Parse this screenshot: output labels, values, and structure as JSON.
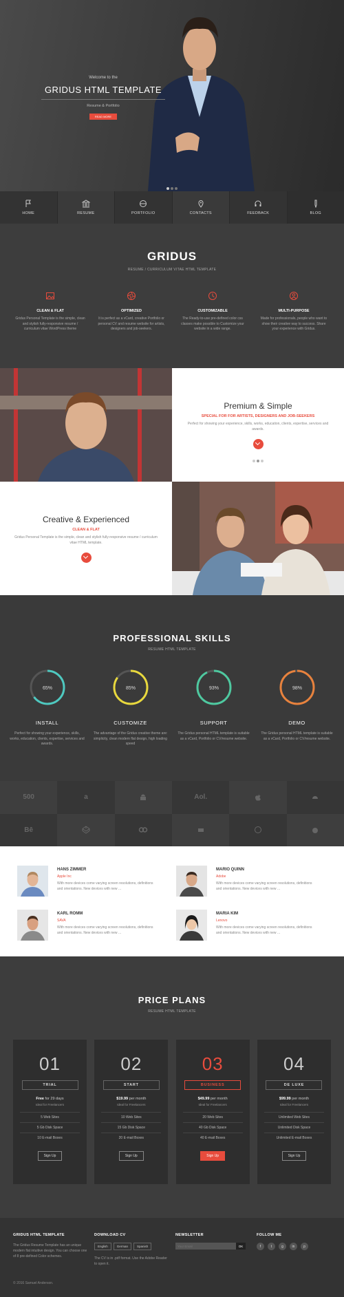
{
  "hero": {
    "welcome": "Welcome to the",
    "title": "GRIDUS HTML TEMPLATE",
    "subtitle": "Resume & Portfolio",
    "button": "READ MORE"
  },
  "nav": [
    {
      "label": "HOME",
      "icon": "flag-icon"
    },
    {
      "label": "RESUME",
      "icon": "bank-icon"
    },
    {
      "label": "PORTFOLIO",
      "icon": "globe-icon"
    },
    {
      "label": "CONTACTS",
      "icon": "pin-icon"
    },
    {
      "label": "FEEDBACK",
      "icon": "headset-icon"
    },
    {
      "label": "BLOG",
      "icon": "pen-icon"
    }
  ],
  "intro": {
    "title": "GRIDUS",
    "subtitle": "RESUME / CURRICULUM VITAE HTML TEMPLATE",
    "features": [
      {
        "title": "CLEAN & FLAT",
        "desc": "Gridus Personal Template is the simple, clean and stylish fully-responsive resume / curriculum vitae WordPress theme",
        "icon": "image-icon"
      },
      {
        "title": "OPTIMIZED",
        "desc": "It is perfect as a vCard, creative Portfolio or personal CV and resume website for artists, designers and job-seekers.",
        "icon": "aperture-icon"
      },
      {
        "title": "CUSTOMIZABLE",
        "desc": "The Ready-to-use pre-defined color css classes make possible to Customize your website in a wide range.",
        "icon": "clock-icon"
      },
      {
        "title": "MULTI-PURPOSE",
        "desc": "Made for professionals, people who want to show their creative way to success. Share your experience with Gridus.",
        "icon": "user-icon"
      }
    ]
  },
  "block1": {
    "title": "Premium & Simple",
    "sub": "SPECIAL FOR FOR ARTISTS, DESIGNERS AND JOB-SEEKERS",
    "desc": "Perfect for showing your experience, skills, works, education, clients, expertise, services and awards."
  },
  "block2": {
    "title": "Creative & Experienced",
    "sub": "CLEAN & FLAT",
    "desc": "Gridus Personal Template is the simple, clean and stylish fully-responsive resume / curriculum vitae HTML template."
  },
  "skills": {
    "title": "PROFESSIONAL SKILLS",
    "subtitle": "RESUME HTML TEMPLATE",
    "items": [
      {
        "pct": "65%",
        "value": 0.65,
        "color": "#4ec9c0",
        "title": "INSTALL",
        "desc": "Perfect for showing your experience, skills, works, education, clients, expertise, services and awards."
      },
      {
        "pct": "85%",
        "value": 0.85,
        "color": "#e8d83d",
        "title": "CUSTOMIZE",
        "desc": "The advantage of the Gridus creative theme are: simplicity, clean modern flat design, high loading speed"
      },
      {
        "pct": "93%",
        "value": 0.93,
        "color": "#4ec9a0",
        "title": "SUPPORT",
        "desc": "The Gridus personal HTML template is suitable as a vCard, Portfolio or CV/resume website."
      },
      {
        "pct": "98%",
        "value": 0.98,
        "color": "#e8823d",
        "title": "DEMO",
        "desc": "The Gridus personal HTML template is suitable as a vCard, Portfolio or CV/resume website."
      }
    ]
  },
  "brands": [
    {
      "label": "500",
      "icon": "500px-icon"
    },
    {
      "label": "a",
      "icon": "amazon-icon"
    },
    {
      "label": "",
      "icon": "android-icon"
    },
    {
      "label": "Aol.",
      "icon": "aol-icon"
    },
    {
      "label": "",
      "icon": "apple-icon"
    },
    {
      "label": "",
      "icon": "cloud-icon"
    },
    {
      "label": "Bē",
      "icon": "behance-icon"
    },
    {
      "label": "",
      "icon": "codepen-icon"
    },
    {
      "label": "",
      "icon": "creative-commons-icon"
    },
    {
      "label": "",
      "icon": "delicious-icon"
    },
    {
      "label": "",
      "icon": "dribbble-icon"
    },
    {
      "label": "",
      "icon": "drupal-icon"
    }
  ],
  "team": [
    {
      "name": "HANS ZIMMER",
      "role": "Apple Inc",
      "desc": "With more devices come varying screen resolutions, definitions and orientations. New devices with new ..."
    },
    {
      "name": "MARIO QUINN",
      "role": "Adobe",
      "desc": "With more devices come varying screen resolutions, definitions and orientations. New devices with new ..."
    },
    {
      "name": "KARL ROMM",
      "role": "SAVA",
      "desc": "With more devices come varying screen resolutions, definitions and orientations. New devices with new ..."
    },
    {
      "name": "MARIA KIM",
      "role": "Lenovo",
      "desc": "With more devices come varying screen resolutions, definitions and orientations. New devices with new ..."
    }
  ],
  "pricing": {
    "title": "PRICE PLANS",
    "subtitle": "RESUME HTML TEMPLATE",
    "plans": [
      {
        "num": "01",
        "name": "TRIAL",
        "price_bold": "Free",
        "price_rest": " for 29 days",
        "note": "Ideal for Freelancers",
        "features": [
          "5 Web Sites",
          "5 Gb Disk Space",
          "10 E-mail Boxes"
        ],
        "button": "Sign Up"
      },
      {
        "num": "02",
        "name": "START",
        "price_bold": "$19.99",
        "price_rest": " per month",
        "note": "Ideal for Freelancers",
        "features": [
          "10 Web Sites",
          "15 Gb Disk Space",
          "20 E-mail Boxes"
        ],
        "button": "Sign Up"
      },
      {
        "num": "03",
        "name": "BUSINESS",
        "price_bold": "$49.99",
        "price_rest": " per month",
        "note": "Ideal for Freelancers",
        "features": [
          "20 Web Sites",
          "40 Gb Disk Space",
          "40 E-mail Boxes"
        ],
        "button": "Sign Up"
      },
      {
        "num": "04",
        "name": "DE LUXE",
        "price_bold": "$99.99",
        "price_rest": " per month",
        "note": "Ideal for Freelancers",
        "features": [
          "Unlimited Web Sites",
          "Unlimited Disk Space",
          "Unlimited E-mail Boxes"
        ],
        "button": "Sign Up"
      }
    ]
  },
  "footer": {
    "col1_title": "GRIDUS HTML TEMPLATE",
    "col1_text": "The Gridus Resume Template has an unique modern flat intuitive design. You can choose one of 8 pre-defined Color schemes.",
    "col2_title": "DOWNLOAD CV",
    "langs": [
      "English",
      "German",
      "Spanish"
    ],
    "col2_text": "The CV is in .pdf format. Use the Adobe Reader to open it.",
    "col3_title": "NEWSLETTER",
    "newsletter_placeholder": "Your Email",
    "newsletter_btn": "OK",
    "col4_title": "FOLLOW ME",
    "socials": [
      "f",
      "t",
      "g",
      "in",
      "p"
    ],
    "copyright": "© 2016 Samuel Anderson."
  }
}
